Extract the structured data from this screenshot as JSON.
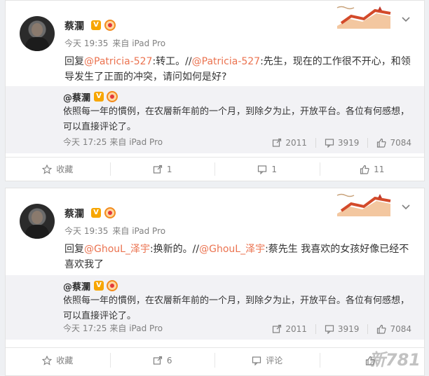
{
  "posts": [
    {
      "author": "蔡瀾",
      "verified": "V",
      "time": "今天 19:35",
      "source": "来自 iPad Pro",
      "content": {
        "p1": "回复",
        "m1": "@Patricia-527",
        "p2": ":转工。//",
        "m2": "@Patricia-527",
        "p3": ":先生，现在的工作很不开心，和领导发生了正面的冲突，请问如何是好?"
      },
      "quote": {
        "author": "@蔡瀾",
        "verified": "V",
        "text": "依照每一年的慣例，在农層新年前的一个月，到除夕为止，开放平台。各位有何感想，可以直接评论了。",
        "time": "今天 17:25",
        "source": "来自 iPad Pro",
        "reposts": "2011",
        "comments": "3919",
        "likes": "7084"
      },
      "actions": {
        "favorite": "收藏",
        "repost": "1",
        "comment": "1",
        "like": "11"
      }
    },
    {
      "author": "蔡瀾",
      "verified": "V",
      "time": "今天 19:35",
      "source": "来自 iPad Pro",
      "content": {
        "p1": "回复",
        "m1": "@GhouL_泽宇",
        "p2": ":换新的。//",
        "m2": "@GhouL_泽宇",
        "p3": ":蔡先生 我喜欢的女孩好像已经不喜欢我了"
      },
      "quote": {
        "author": "@蔡瀾",
        "verified": "V",
        "text": "依照每一年的慣例，在农層新年前的一个月，到除夕为止，开放平台。各位有何感想，可以直接评论了。",
        "time": "今天 17:25",
        "source": "来自 iPad Pro",
        "reposts": "2011",
        "comments": "3919",
        "likes": "7084"
      },
      "actions": {
        "favorite": "收藏",
        "repost": "6",
        "comment": "评论",
        "like": ""
      }
    }
  ],
  "watermark": "新781",
  "colors": {
    "mention": "#eb7350",
    "verified_badge": "#f7a600",
    "quote_bg": "#f2f2f5"
  }
}
